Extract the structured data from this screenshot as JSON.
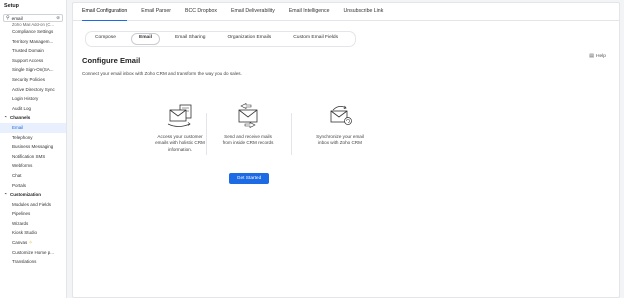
{
  "sidebar": {
    "title": "Setup",
    "search": {
      "value": "email",
      "clear": "⊗"
    },
    "partial_item": "Zoho Mail Add-on (C...",
    "items": [
      {
        "label": "Compliance Settings"
      },
      {
        "label": "Territory Managem..."
      },
      {
        "label": "Trusted Domain"
      },
      {
        "label": "Support Access"
      },
      {
        "label": "Single Sign-On(SA..."
      },
      {
        "label": "Security Policies"
      },
      {
        "label": "Active Directory Sync"
      },
      {
        "label": "Login History"
      },
      {
        "label": "Audit Log"
      }
    ],
    "channels_section": "Channels",
    "channels": [
      {
        "label": "Email",
        "active": true
      },
      {
        "label": "Telephony"
      },
      {
        "label": "Business Messaging"
      },
      {
        "label": "Notification SMS"
      },
      {
        "label": "Webforms"
      },
      {
        "label": "Chat"
      },
      {
        "label": "Portals"
      }
    ],
    "customization_section": "Customization",
    "customization": [
      {
        "label": "Modules and Fields"
      },
      {
        "label": "Pipelines"
      },
      {
        "label": "Wizards"
      },
      {
        "label": "Kiosk Studio"
      },
      {
        "label": "Canvas"
      },
      {
        "label": "Customize Home p..."
      },
      {
        "label": "Translations"
      }
    ]
  },
  "tabs": [
    "Email Configuration",
    "Email Parser",
    "BCC Dropbox",
    "Email Deliverability",
    "Email Intelligence",
    "Unsubscribe Link"
  ],
  "subtabs": [
    "Compose",
    "Email",
    "Email Sharing",
    "Organization Emails",
    "Custom Email Fields"
  ],
  "page": {
    "title": "Configure Email",
    "help": "Help",
    "description": "Connect your email inbox with Zoho CRM and transform the way you do sales."
  },
  "features": [
    {
      "icon": "email-context-icon",
      "lines": [
        "Access your customer",
        "emails with holistic CRM",
        "information."
      ]
    },
    {
      "icon": "send-receive-mail-icon",
      "lines": [
        "Send and receive mails",
        "from inside CRM records"
      ]
    },
    {
      "icon": "sync-mail-icon",
      "lines": [
        "Synchronize your email",
        "inbox with Zoho CRM"
      ]
    }
  ],
  "cta": "Get Started",
  "colors": {
    "accent": "#1d6ae5",
    "active_bg": "#e8f0fd"
  }
}
